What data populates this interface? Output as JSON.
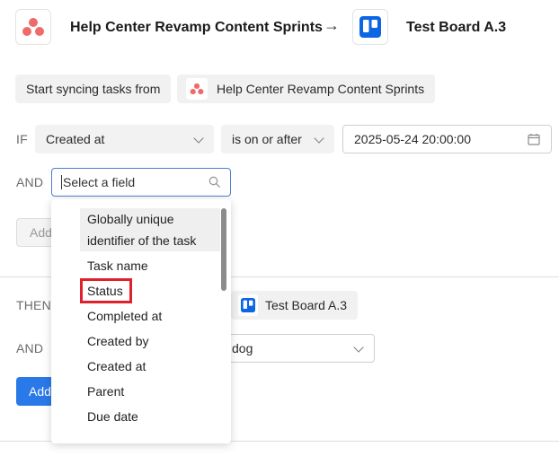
{
  "header": {
    "source_title": "Help Center Revamp Content Sprints",
    "arrow": "→",
    "target_title": "Test Board A.3",
    "source_icon": "asana-icon",
    "target_icon": "trello-icon",
    "colors": {
      "asana": "#f06a6a",
      "trello": "#0c66e4"
    }
  },
  "sync": {
    "label": "Start syncing tasks from",
    "source_chip": "Help Center Revamp Content Sprints"
  },
  "if_row": {
    "label": "IF",
    "field": "Created at",
    "operator": "is on or after",
    "value": "2025-05-24 20:00:00"
  },
  "and_row": {
    "label": "AND",
    "search_placeholder": "Select a field"
  },
  "add_button_1": "Add",
  "then_row": {
    "label": "THEN",
    "target_chip": "Test Board A.3"
  },
  "and_row_2": {
    "label": "AND",
    "select_value": "dog"
  },
  "add_button_2": "Add",
  "dropdown": {
    "items": [
      "Globally unique identifier of the task",
      "Task name",
      "Status",
      "Completed at",
      "Created by",
      "Created at",
      "Parent",
      "Due date"
    ],
    "highlighted": "Status",
    "highlight_color": "#e0202a"
  }
}
